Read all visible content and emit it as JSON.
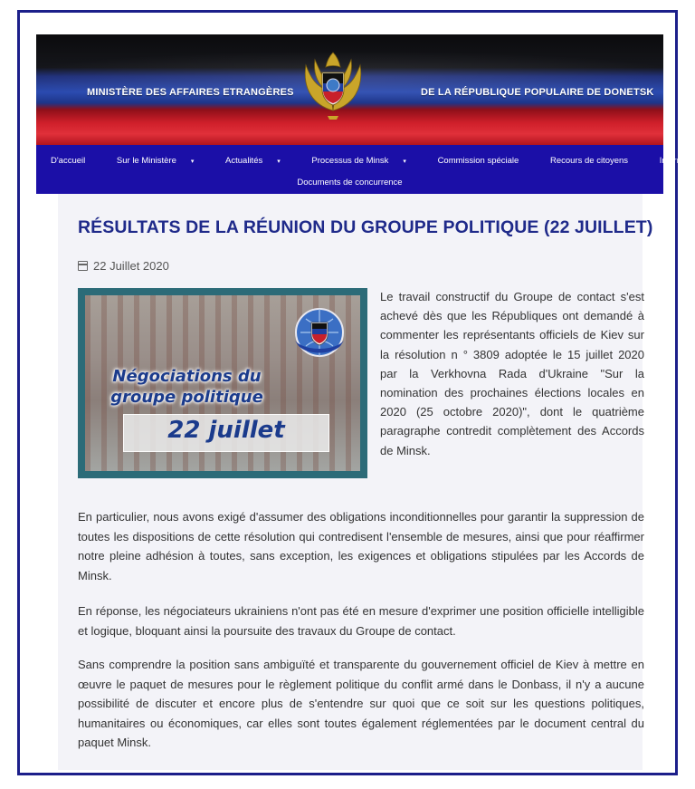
{
  "header": {
    "left_title": "MINISTÈRE DES AFFAIRES ETRANGÈRES",
    "right_title": "DE LA RÉPUBLIQUE POPULAIRE DE DONETSK",
    "emblem_icon": "eagle-emblem-icon",
    "colors": {
      "black": "#0b0b0d",
      "blue": "#2b4bb0",
      "red": "#cf1f2a",
      "nav": "#1b0fa7",
      "frame": "#1c1f8a"
    }
  },
  "nav": {
    "items": [
      {
        "label": "D'accueil",
        "has_caret": false
      },
      {
        "label": "Sur le Ministère",
        "has_caret": true
      },
      {
        "label": "Actualités",
        "has_caret": true
      },
      {
        "label": "Processus de Minsk",
        "has_caret": true
      },
      {
        "label": "Commission spéciale",
        "has_caret": false
      },
      {
        "label": "Recours de citoyens",
        "has_caret": false
      },
      {
        "label": "Information utile",
        "has_caret": false
      }
    ],
    "second_row": "Documents de concurrence",
    "caret": "▾"
  },
  "article": {
    "title": "RÉSULTATS DE LA RÉUNION DU GROUPE POLITIQUE (22 JUILLET)",
    "date": "22 Juillet 2020",
    "image": {
      "title_line1": "Négociations du",
      "title_line2": "groupe politique",
      "date_text": "22 juillet"
    },
    "paragraphs": [
      "Le travail constructif du Groupe de contact s'est achevé dès que les Républiques ont demandé à commenter les représentants officiels de Kiev sur la résolution n ° 3809 adoptée le 15 juillet 2020 par la Verkhovna Rada d'Ukraine \"Sur la nomination des prochaines élections locales en 2020 (25 octobre 2020)\", dont le quatrième paragraphe contredit complètement des Accords de Minsk.",
      "En particulier, nous avons exigé d'assumer des obligations inconditionnelles pour garantir la suppression de toutes les dispositions de cette résolution qui contredisent l'ensemble de mesures, ainsi que pour réaffirmer notre pleine adhésion à toutes, sans exception, les exigences et obligations stipulées par les Accords de Minsk.",
      "En réponse, les négociateurs ukrainiens n'ont pas été en mesure d'exprimer une position officielle intelligible et logique, bloquant ainsi la poursuite des travaux du Groupe de contact.",
      "Sans comprendre la position sans ambiguïté et transparente du gouvernement officiel de Kiev à mettre en œuvre le paquet de mesures pour le règlement politique du conflit armé dans le Donbass, il n'y a aucune possibilité de discuter et encore plus de s'entendre sur quoi que ce soit sur les questions politiques, humanitaires ou économiques, car elles sont toutes également réglementées par le document central du paquet Minsk."
    ]
  }
}
